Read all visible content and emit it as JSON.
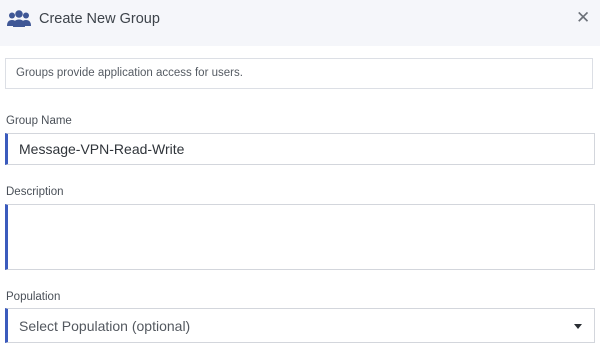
{
  "dialog": {
    "title": "Create New Group",
    "close_icon": "close-icon",
    "header_icon": "users-group-icon"
  },
  "info_text": "Groups provide application access for users.",
  "fields": {
    "group_name": {
      "label": "Group Name",
      "value": "Message-VPN-Read-Write"
    },
    "description": {
      "label": "Description",
      "value": ""
    },
    "population": {
      "label": "Population",
      "placeholder": "Select Population (optional)"
    }
  },
  "colors": {
    "accent": "#3b5bbd",
    "header_bg": "#f5f6fa"
  }
}
